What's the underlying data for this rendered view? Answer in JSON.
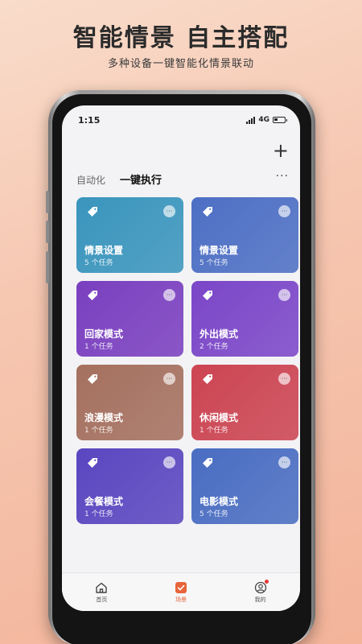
{
  "headline": "智能情景 自主搭配",
  "subline": "多种设备一键智能化情景联动",
  "status": {
    "time": "1:15",
    "network": "4G"
  },
  "header": {
    "add_label": "+",
    "more_label": "···"
  },
  "tabs": [
    {
      "label": "自动化"
    },
    {
      "label": "一键执行"
    }
  ],
  "cards": [
    {
      "title": "情景设置",
      "sub": "5 个任务",
      "color": "#3a95bd"
    },
    {
      "title": "情景设置",
      "sub": "5 个任务",
      "color": "#4d6fc4"
    },
    {
      "title": "回家模式",
      "sub": "1 个任务",
      "color": "#7a3fbf"
    },
    {
      "title": "外出模式",
      "sub": "2 个任务",
      "color": "#7b46c8"
    },
    {
      "title": "浪漫模式",
      "sub": "1 个任务",
      "color": "#a5705f"
    },
    {
      "title": "休闲模式",
      "sub": "1 个任务",
      "color": "#cc4452"
    },
    {
      "title": "会餐模式",
      "sub": "1 个任务",
      "color": "#5a46c0"
    },
    {
      "title": "电影模式",
      "sub": "5 个任务",
      "color": "#4a6dc2"
    }
  ],
  "card_more_label": "···",
  "bottom_nav": [
    {
      "label": "首页",
      "icon": "home-icon"
    },
    {
      "label": "场景",
      "icon": "scene-icon",
      "active": true
    },
    {
      "label": "我的",
      "icon": "profile-icon"
    }
  ],
  "colors": {
    "accent": "#e8643a",
    "badge": "#e53935"
  }
}
